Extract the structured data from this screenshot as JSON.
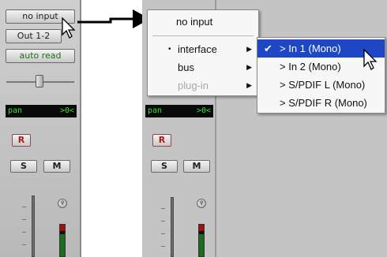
{
  "left_strip": {
    "input_label": "no input",
    "output_label": "Out 1-2",
    "automation_label": "auto read",
    "pan_label": "pan",
    "pan_value": ">0<",
    "record_label": "R",
    "solo_label": "S",
    "mute_label": "M"
  },
  "right_strip": {
    "pan_label": "pan",
    "pan_value": ">0<",
    "record_label": "R",
    "solo_label": "S",
    "mute_label": "M"
  },
  "input_menu": {
    "title": "no input",
    "items": [
      {
        "label": "interface",
        "bullet": "•",
        "submenu": "▶",
        "enabled": true
      },
      {
        "label": "bus",
        "submenu": "▶",
        "enabled": true
      },
      {
        "label": "plug-in",
        "submenu": "▶",
        "enabled": false
      }
    ]
  },
  "interface_submenu": {
    "check": "✔",
    "items": [
      {
        "label": "> In 1 (Mono)",
        "selected": true
      },
      {
        "label": "> In 2 (Mono)",
        "selected": false
      },
      {
        "label": "> S/PDIF L (Mono)",
        "selected": false
      },
      {
        "label": "> S/PDIF R (Mono)",
        "selected": false
      }
    ]
  },
  "colors": {
    "menu_selection": "#1d47c4",
    "lcd_text": "#38e038",
    "record_red": "#b01818",
    "automation_green": "#1c6b1c"
  },
  "icons": [
    "pointer-cursor-icon",
    "checkmark-icon",
    "submenu-arrow-icon",
    "callout-arrow-icon",
    "pan-knob-icon"
  ]
}
